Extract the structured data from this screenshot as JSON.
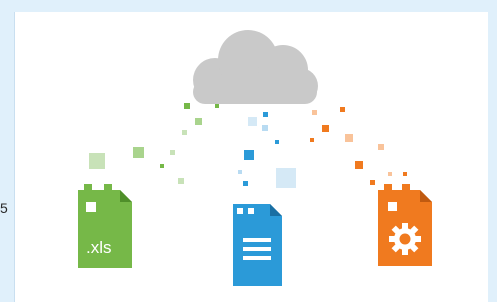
{
  "side_glyph": "5",
  "icons": {
    "cloud": "cloud-icon",
    "spreadsheet_file": "spreadsheet-file-icon",
    "document_file": "document-file-icon",
    "settings_file": "settings-file-icon",
    "gear": "gear-icon"
  },
  "files": {
    "spreadsheet_label": ".xls"
  },
  "colors": {
    "background": "#d8ebf8",
    "cloud": "#c9c9c9",
    "green": "#76b848",
    "blue": "#2b9ad8",
    "orange": "#f07a1f"
  }
}
